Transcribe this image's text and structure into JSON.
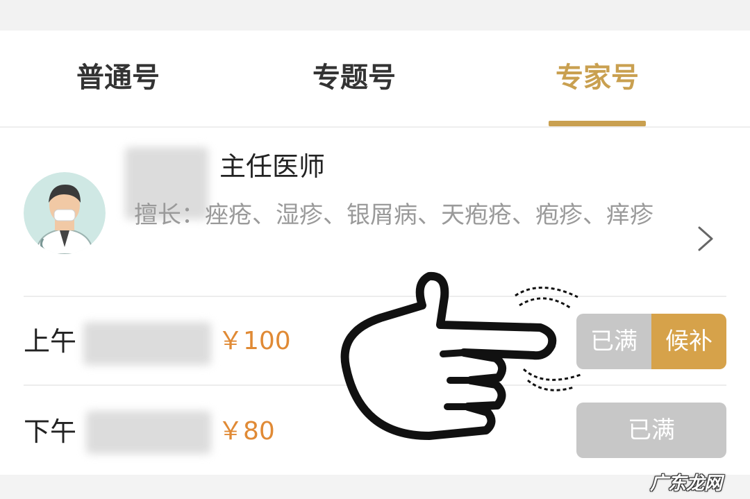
{
  "tabs": [
    {
      "label": "普通号"
    },
    {
      "label": "专题号"
    },
    {
      "label": "专家号",
      "active": true
    }
  ],
  "doctor": {
    "title": "主任医师",
    "specialty": "擅长：痤疮、湿疹、银屑病、天疱疮、疱疹、痒疹"
  },
  "slots": [
    {
      "period": "上午",
      "price": "￥100",
      "status": "已满",
      "waitlist": "候补"
    },
    {
      "period": "下午",
      "price": "￥80",
      "status": "已满"
    }
  ],
  "watermark": "广东龙网",
  "colors": {
    "accent": "#c9a050",
    "price": "#e08a35",
    "disabled": "#c7c7c7",
    "waitlist": "#d6a24a"
  }
}
